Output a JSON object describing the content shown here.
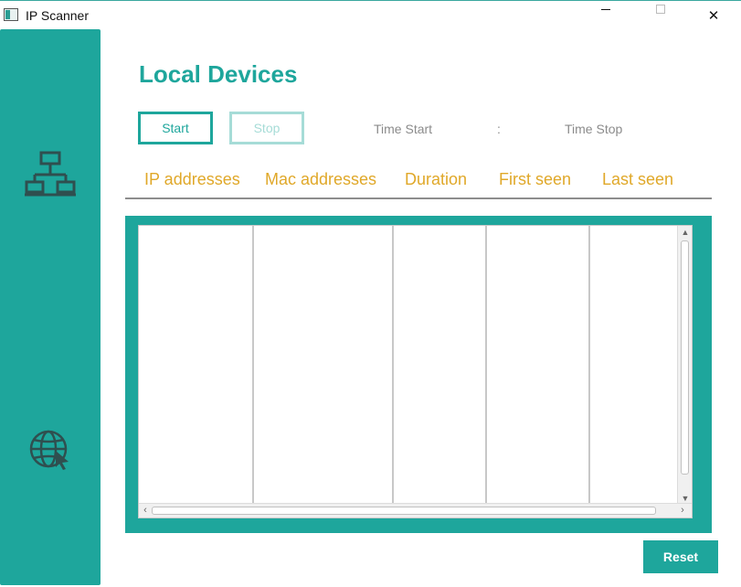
{
  "window": {
    "title": "IP Scanner",
    "close_glyph": "✕"
  },
  "sidebar": {
    "items": [
      {
        "icon": "network-icon"
      },
      {
        "icon": "globe-cursor-icon"
      }
    ]
  },
  "main": {
    "title": "Local Devices",
    "start_label": "Start",
    "stop_label": "Stop",
    "time_start_label": "Time Start",
    "time_separator": ":",
    "time_stop_label": "Time Stop",
    "columns": [
      "IP addresses",
      "Mac addresses",
      "Duration",
      "First seen",
      "Last seen"
    ],
    "rows": [],
    "reset_label": "Reset"
  },
  "colors": {
    "accent": "#1ea69c",
    "accent_light": "#a6dcd7",
    "header_text": "#e0a829",
    "muted_text": "#8b8b8b"
  }
}
